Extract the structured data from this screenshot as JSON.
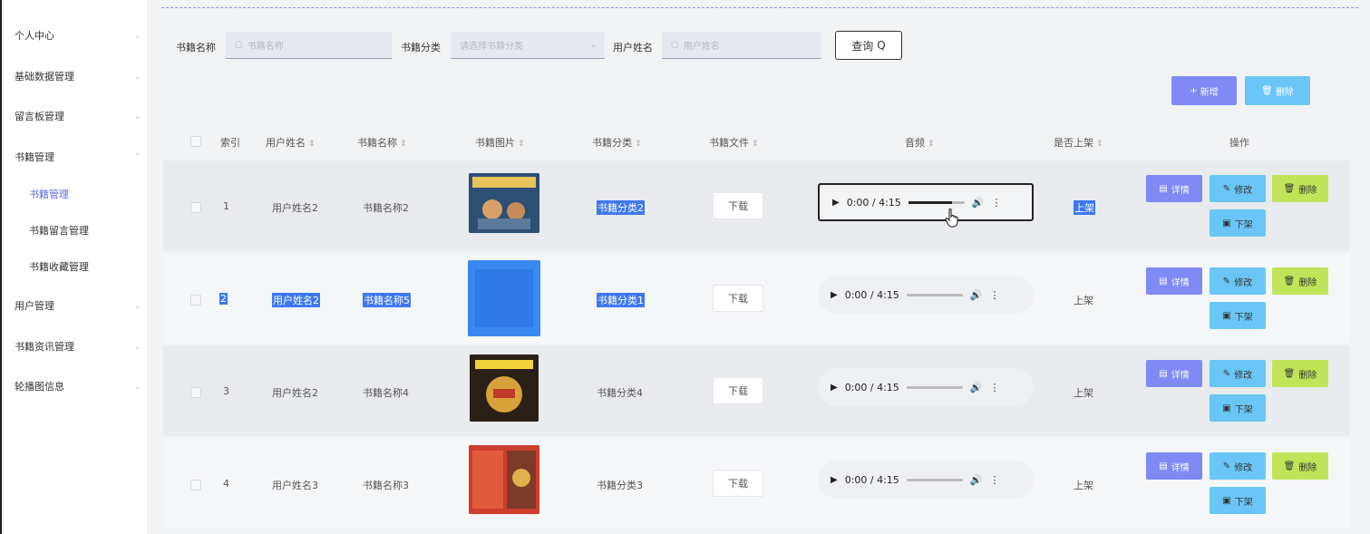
{
  "sidebar": {
    "items": [
      {
        "label": "个人中心"
      },
      {
        "label": "基础数据管理"
      },
      {
        "label": "留言板管理"
      },
      {
        "label": "书籍管理"
      },
      {
        "label": "书籍管理"
      },
      {
        "label": "书籍留言管理"
      },
      {
        "label": "书籍收藏管理"
      },
      {
        "label": "用户管理"
      },
      {
        "label": "书籍资讯管理"
      },
      {
        "label": "轮播图信息"
      }
    ]
  },
  "search": {
    "book_name_label": "书籍名称",
    "book_name_placeholder": "书籍名称",
    "category_label": "书籍分类",
    "category_placeholder": "请选择书籍分类",
    "user_name_label": "用户姓名",
    "user_name_placeholder": "用户姓名",
    "query_label": "查询"
  },
  "toolbar": {
    "add_label": "新增",
    "delete_label": "删除"
  },
  "table": {
    "headers": {
      "index": "索引",
      "user_name": "用户姓名",
      "book_name": "书籍名称",
      "book_image": "书籍图片",
      "category": "书籍分类",
      "book_file": "书籍文件",
      "audio": "音频",
      "on_shelf": "是否上架",
      "actions": "操作"
    },
    "rows": [
      {
        "index": "1",
        "user_name": "用户姓名2",
        "book_name": "书籍名称2",
        "category": "书籍分类2",
        "download": "下载",
        "audio_time": "0:00 / 4:15",
        "on_shelf": "上架",
        "detail": "详情",
        "edit": "修改",
        "delete": "删除",
        "off_shelf": "下架"
      },
      {
        "index": "2",
        "user_name": "用户姓名2",
        "book_name": "书籍名称5",
        "category": "书籍分类1",
        "download": "下载",
        "audio_time": "0:00 / 4:15",
        "on_shelf": "上架",
        "detail": "详情",
        "edit": "修改",
        "delete": "删除",
        "off_shelf": "下架"
      },
      {
        "index": "3",
        "user_name": "用户姓名2",
        "book_name": "书籍名称4",
        "category": "书籍分类4",
        "download": "下载",
        "audio_time": "0:00 / 4:15",
        "on_shelf": "上架",
        "detail": "详情",
        "edit": "修改",
        "delete": "删除",
        "off_shelf": "下架"
      },
      {
        "index": "4",
        "user_name": "用户姓名3",
        "book_name": "书籍名称3",
        "category": "书籍分类3",
        "download": "下载",
        "audio_time": "0:00 / 4:15",
        "on_shelf": "上架",
        "detail": "详情",
        "edit": "修改",
        "delete": "删除",
        "off_shelf": "下架"
      }
    ]
  },
  "colors": {
    "accent": "#7f8af5",
    "info": "#69c6f6",
    "warn": "#c1e45a",
    "selection": "#3e78f0",
    "active_menu": "#5b6be0"
  }
}
